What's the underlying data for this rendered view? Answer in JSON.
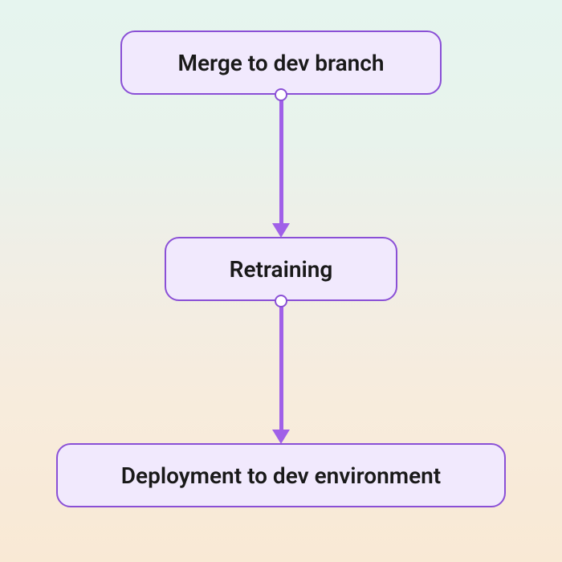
{
  "diagram": {
    "type": "flowchart",
    "direction": "top-to-bottom",
    "colors": {
      "node_fill": "#f1e9fd",
      "node_border": "#8a4fd6",
      "arrow": "#a060e8",
      "port_fill": "#ffffff"
    },
    "nodes": [
      {
        "id": "n1",
        "label": "Merge to dev branch"
      },
      {
        "id": "n2",
        "label": "Retraining"
      },
      {
        "id": "n3",
        "label": "Deployment to dev environment"
      }
    ],
    "edges": [
      {
        "from": "n1",
        "to": "n2"
      },
      {
        "from": "n2",
        "to": "n3"
      }
    ]
  }
}
